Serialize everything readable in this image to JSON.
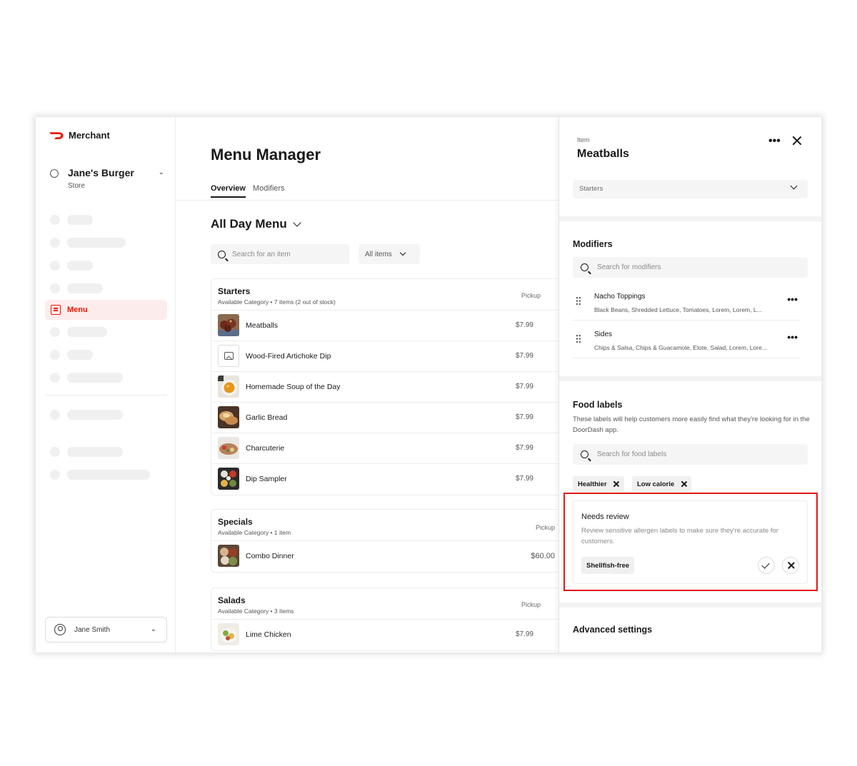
{
  "brand": {
    "name": "Merchant"
  },
  "store": {
    "name": "Jane's Burger",
    "type": "Store"
  },
  "sidebar": {
    "active_item": "Menu"
  },
  "user": {
    "name": "Jane Smith"
  },
  "main": {
    "title": "Menu Manager",
    "tabs": [
      {
        "label": "Overview",
        "active": true
      },
      {
        "label": "Modifiers",
        "active": false
      }
    ],
    "menu_select": "All Day Menu",
    "search_placeholder": "Search for an item",
    "filter_label": "All items",
    "categories": [
      {
        "title": "Starters",
        "subtitle": "Available Category  •  7 items (2 out of stock)",
        "pickup": "Pickup",
        "items": [
          {
            "name": "Meatballs",
            "price": "$7.99",
            "image": "meatballs"
          },
          {
            "name": "Wood-Fired Artichoke Dip",
            "price": "$7.99",
            "image": "placeholder"
          },
          {
            "name": "Homemade Soup of the Day",
            "price": "$7.99",
            "image": "soup"
          },
          {
            "name": "Garlic Bread",
            "price": "$7.99",
            "image": "bread"
          },
          {
            "name": "Charcuterie",
            "price": "$7.99",
            "image": "charcuterie"
          },
          {
            "name": "Dip Sampler",
            "price": "$7.99",
            "image": "dips"
          }
        ]
      },
      {
        "title": "Specials",
        "subtitle": "Available Category  •  1 item",
        "pickup": "Pickup",
        "items": [
          {
            "name": "Combo Dinner",
            "price": "$60.00",
            "image": "combo"
          }
        ]
      },
      {
        "title": "Salads",
        "subtitle": "Available Category  •  3 items",
        "pickup": "Pickup",
        "items": [
          {
            "name": "Lime Chicken",
            "price": "$7.99",
            "image": "salad"
          }
        ]
      }
    ]
  },
  "panel": {
    "overline": "Item",
    "title": "Meatballs",
    "category_select": "Starters",
    "modifiers": {
      "title": "Modifiers",
      "search_placeholder": "Search for modifiers",
      "items": [
        {
          "name": "Nacho Toppings",
          "description": "Black Beans, Shredded Lettuce, Tomatoes, Lorem, Lorem, L..."
        },
        {
          "name": "Sides",
          "description": "Chips & Salsa, Chips & Guacamole, Elote, Salad, Lorem, Lore..."
        }
      ]
    },
    "food_labels": {
      "title": "Food labels",
      "description": "These labels will help customers more easily find what they're looking for in the DoorDash app.",
      "search_placeholder": "Search for food labels",
      "chips": [
        "Healthier",
        "Low calorie"
      ]
    },
    "needs_review": {
      "title": "Needs review",
      "description": "Review sensitive allergen labels to make sure they're accurate for customers.",
      "label": "Shellfish-free"
    },
    "advanced_settings": {
      "title": "Advanced settings"
    }
  },
  "colors": {
    "brand_red": "#eb1700",
    "highlight_red": "#e31818",
    "active_nav_bg": "#fdecec"
  }
}
